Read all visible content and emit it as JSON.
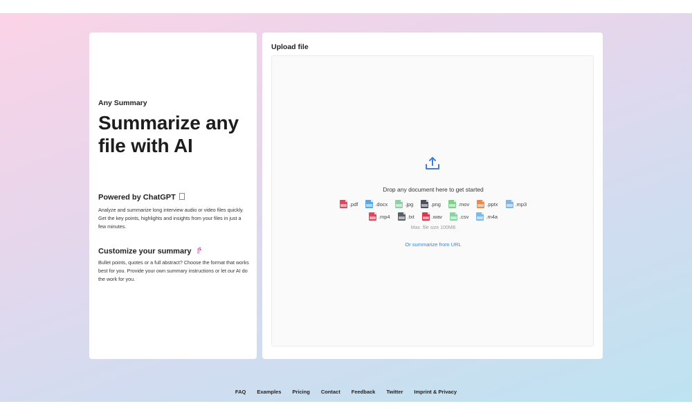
{
  "left": {
    "eyebrow": "Any Summary",
    "hero": "Summarize any file with AI",
    "features": [
      {
        "title": "Powered by ChatGPT",
        "text": "Analyze and summarize long interview audio or video files quickly. Get the key points, highlights and insights from your files in just a few minutes."
      },
      {
        "title": "Customize your summary",
        "text": "Bullet points, quotes or a full abstract? Choose the format that works best for you. Provide your own summary instructions or let our AI do the work for you."
      }
    ]
  },
  "upload": {
    "title": "Upload file",
    "drop_text": "Drop any document here to get started",
    "file_types_row1": [
      {
        "label": ".pdf",
        "color": "#e0475c"
      },
      {
        "label": ".docx",
        "color": "#5aa9e6"
      },
      {
        "label": ".jpg",
        "color": "#8bd3a4"
      },
      {
        "label": ".png",
        "color": "#4a4f5a"
      },
      {
        "label": ".mov",
        "color": "#7bd388"
      },
      {
        "label": ".pptx",
        "color": "#f08a4b"
      },
      {
        "label": ".mp3",
        "color": "#7fb8e6"
      }
    ],
    "file_types_row2": [
      {
        "label": ".mp4",
        "color": "#e0475c"
      },
      {
        "label": ".txt",
        "color": "#5b5f66"
      },
      {
        "label": ".wav",
        "color": "#d9394f"
      },
      {
        "label": ".csv",
        "color": "#8bd3a4"
      },
      {
        "label": ".m4a",
        "color": "#7fb8e6"
      }
    ],
    "max_size": "Max. file size 100MB",
    "url_link": "Or summarize from URL",
    "accent": "#3b82d6"
  },
  "footer": {
    "links": [
      "FAQ",
      "Examples",
      "Pricing",
      "Contact",
      "Feedback",
      "Twitter",
      "Imprint & Privacy"
    ]
  }
}
